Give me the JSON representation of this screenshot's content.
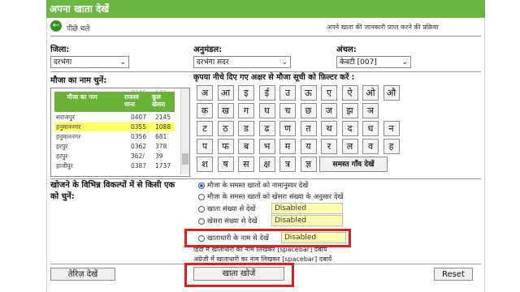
{
  "header": {
    "title": "अपना खाता देखें",
    "process_link": "अपने खाता की जानकारी प्राप्त करने की प्रक्रिया"
  },
  "back": {
    "label": "पीछे चले"
  },
  "filters": {
    "district": {
      "label": "जिला:",
      "value": "दरभंगा"
    },
    "subdivision": {
      "label": "अनुमंडल:",
      "value": "दरभंगा सदर"
    },
    "circle": {
      "label": "अंचल:",
      "value": "केवटी [007]"
    }
  },
  "mauza": {
    "label": "मौजा का नाम चुनें:",
    "headers": [
      "मौजा का नाम",
      "राजस्व थाना",
      "कुल खेसरा"
    ],
    "partial_top": [
      "...",
      "0346",
      "101"
    ],
    "rows": [
      [
        "सराजपुर",
        "0407",
        "2145"
      ],
      [
        "हनुमाननगर",
        "0355",
        "1088"
      ],
      [
        "हनुमाननगर",
        "0356",
        "681"
      ],
      [
        "हरपुर",
        "0362",
        "378"
      ],
      [
        "हरपुर",
        "362/",
        "39"
      ],
      [
        "हाजीपुर",
        "0387",
        "1737"
      ]
    ],
    "selected_index": 1
  },
  "alphabet": {
    "instruction": "कृपया नीचे दिए गए अक्षर से मौजा सूची को फ़िल्टर करें :",
    "rows": [
      [
        "अ",
        "आ",
        "इ",
        "ई",
        "उ",
        "ऊ",
        "ए",
        "ऐ",
        "ओ",
        "औ"
      ],
      [
        "क",
        "ख",
        "ग",
        "घ",
        "च",
        "छ",
        "ज",
        "झ",
        "ञ"
      ],
      [
        "ट",
        "ठ",
        "ड",
        "ढ",
        "ण",
        "त",
        "थ",
        "द",
        "ध",
        "न"
      ],
      [
        "प",
        "फ",
        "ब",
        "भ",
        "म",
        "य",
        "र",
        "ल",
        "व",
        "ह"
      ],
      [
        "श",
        "ष",
        "स",
        "क्ष",
        "त्र",
        "ज्ञ"
      ]
    ],
    "all_mauza_button": "समस्त गाँव देखें"
  },
  "search_options": {
    "label": "खोजने के विभिन्न विकल्पों में से किसी एक को चुनें:",
    "options": [
      "मौजा के समस्त खातों को नामानुसार देखें",
      "मौजा के समस्त खातों को खेसरा संख्या के अनुसार देखें",
      "खाता संख्या से देखें",
      "खेसरा संख्या से देखें",
      "खाताधारी के नाम से देखें"
    ],
    "disabled_text": "Disabled",
    "hint_line1": "हिंदी में खाताधारी का नाम लिखकर [spacebar] दबायें",
    "hint_line2": "अंग्रेज़ी में खाताधारी का नाम लिखकर [spacebar] दबायें"
  },
  "buttons": {
    "view_register": "तेरिज़ देखें",
    "search_account": "खाता खोजें",
    "reset": "Reset"
  },
  "colors": {
    "brand_green": "#6bb544",
    "highlight_red": "#e0201c",
    "disabled_fill": "#ffffb0",
    "selected_row": "#ffff66"
  }
}
